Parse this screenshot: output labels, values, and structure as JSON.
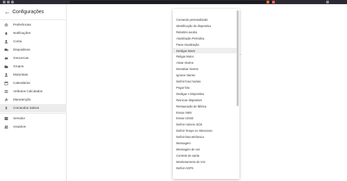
{
  "sidebar": {
    "title": "Configurações",
    "items": [
      {
        "label": "Preferências",
        "icon": "settings-icon"
      },
      {
        "label": "Notificações",
        "icon": "notifications-icon"
      },
      {
        "label": "Conta",
        "icon": "account-icon"
      },
      {
        "label": "Dispositivos",
        "icon": "devices-icon"
      },
      {
        "label": "Geocercas",
        "icon": "geofences-icon"
      },
      {
        "label": "Grupos",
        "icon": "groups-icon"
      },
      {
        "label": "Motoristas",
        "icon": "drivers-icon"
      },
      {
        "label": "Calendários",
        "icon": "calendars-icon"
      },
      {
        "label": "Atributos Calculados",
        "icon": "attributes-icon"
      },
      {
        "label": "Manutenção",
        "icon": "maintenance-icon"
      },
      {
        "label": "Comandos Salvos",
        "icon": "saved-commands-icon"
      },
      {
        "label": "Servidor",
        "icon": "server-icon"
      },
      {
        "label": "Usuários",
        "icon": "users-icon"
      }
    ],
    "active_item": "Comandos Salvos"
  },
  "dropdown": {
    "highlighted": "Desligar Motor",
    "options": [
      "Comando personalizado",
      "Identificação do dispositivo",
      "Relatório avulso",
      "Atualização Periódica",
      "Parar Atualização",
      "Desligar Motor",
      "Religar Motor",
      "Ativar Alarme",
      "Desativar Alarme",
      "Ignorar Alarme",
      "Definir fuso horário",
      "Pegar foto",
      "Desligar o Dispositivo",
      "Reiniciar dispositivo",
      "Restauração de fábrica",
      "Enviar SMS",
      "Enviar USSD",
      "Definir número SOS",
      "Definir Tempo no Silencioso",
      "Definir lista telefonica",
      "Mensagem",
      "Mensagem de voz",
      "Controle de saída",
      "Monitoramento de Voz",
      "Definir AGPS"
    ]
  },
  "colors": {
    "browser_bar": "#2b2a33",
    "active_item_bg": "#ececec",
    "icon": "#555555"
  }
}
